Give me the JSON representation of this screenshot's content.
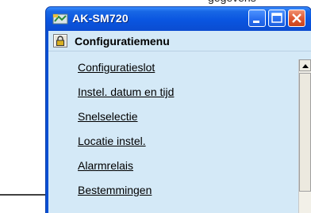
{
  "page": {
    "caption": "figuur ... gegevens"
  },
  "window": {
    "title": "AK-SM720",
    "app_icon": "device-icon",
    "buttons": {
      "minimize_icon": "minimize-icon",
      "maximize_icon": "maximize-icon",
      "close_icon": "close-icon"
    }
  },
  "menu": {
    "title": "Configuratiemenu",
    "lock_icon": "lock-icon",
    "items": [
      {
        "label": "Configuratieslot"
      },
      {
        "label": "Instel. datum en tijd"
      },
      {
        "label": "Snelselectie"
      },
      {
        "label": "Locatie instel."
      },
      {
        "label": "Alarmrelais"
      },
      {
        "label": "Bestemmingen"
      }
    ]
  },
  "annotation": {
    "arrow_icon": "arrow-right-icon",
    "points_to": "Bestemmingen"
  },
  "colors": {
    "titlebar": "#0a55e0",
    "client_bg": "#d4e9f7",
    "close_button": "#e05a34"
  }
}
